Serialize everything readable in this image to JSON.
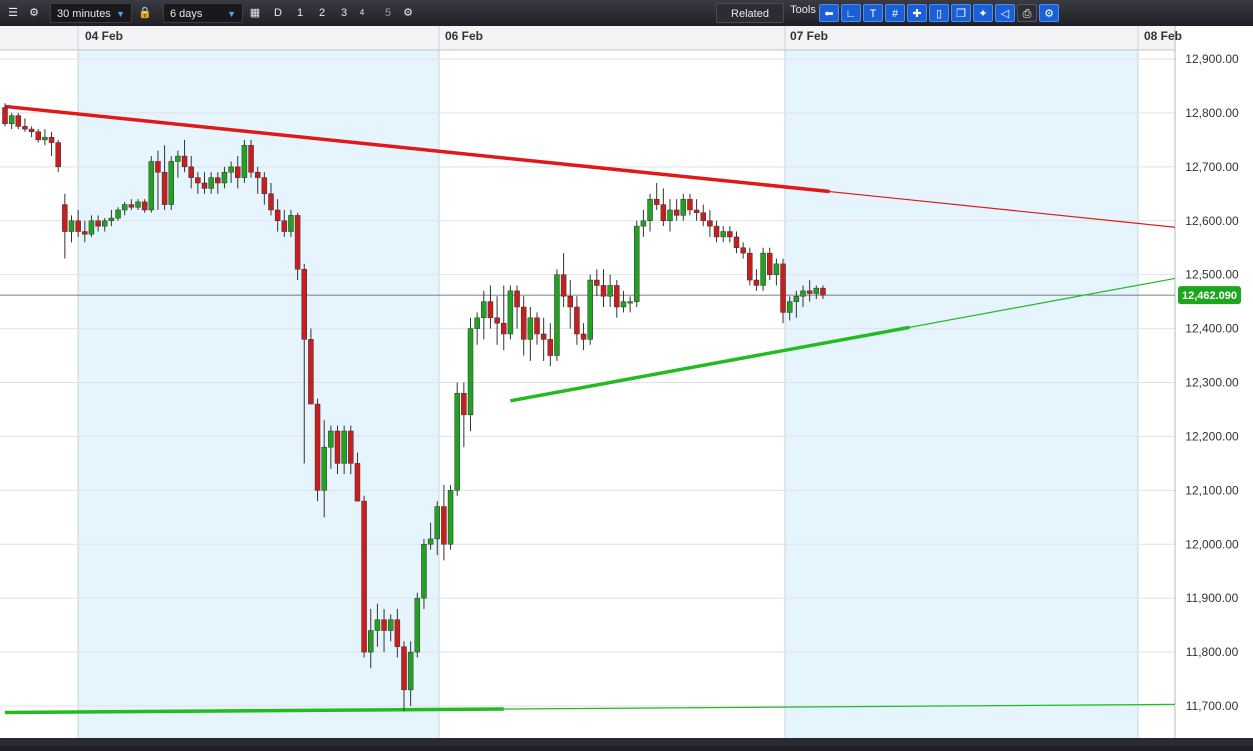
{
  "toolbar": {
    "interval": "30 minutes",
    "range": "6 days",
    "period_buttons": [
      "D",
      "1",
      "2",
      "3",
      "4",
      "5"
    ],
    "related_label": "Related",
    "tools_label": "Tools",
    "tool_icons": [
      "arrow-left-icon",
      "curve-icon",
      "text-icon",
      "grid-icon",
      "crosshair-icon",
      "candle-icon",
      "layers-icon",
      "fan-icon",
      "label-icon",
      "eraser-icon",
      "print-icon",
      "settings-icon"
    ]
  },
  "chart_data": {
    "type": "candlestick",
    "x_ticks": [
      "04 Feb",
      "06 Feb",
      "07 Feb",
      "08 Feb"
    ],
    "y_ticks": [
      "12,900.00",
      "12,800.00",
      "12,700.00",
      "12,600.00",
      "12,500.00",
      "12,400.00",
      "12,300.00",
      "12,200.00",
      "12,100.00",
      "12,000.00",
      "11,900.00",
      "11,800.00",
      "11,700.00"
    ],
    "ylim": [
      11680,
      12930
    ],
    "last_price": "12,462.090",
    "last_price_value": 12462.09,
    "up_color": "#22a122",
    "down_color": "#c81e1e",
    "trendlines": [
      {
        "name": "resistance",
        "color": "#e01818",
        "from": [
          0,
          12812
        ],
        "to": [
          176,
          12588
        ]
      },
      {
        "name": "support",
        "color": "#22bb22",
        "from": [
          76,
          12266
        ],
        "to": [
          176,
          12493
        ]
      },
      {
        "name": "base",
        "color": "#22bb22",
        "from": [
          0,
          11688
        ],
        "to": [
          176,
          11703
        ]
      }
    ],
    "candles": [
      [
        12810,
        12818,
        12775,
        12780
      ],
      [
        12780,
        12800,
        12770,
        12795
      ],
      [
        12795,
        12800,
        12770,
        12775
      ],
      [
        12775,
        12790,
        12765,
        12770
      ],
      [
        12770,
        12775,
        12755,
        12765
      ],
      [
        12765,
        12770,
        12745,
        12750
      ],
      [
        12750,
        12770,
        12740,
        12755
      ],
      [
        12755,
        12765,
        12720,
        12745
      ],
      [
        12745,
        12750,
        12690,
        12700
      ],
      [
        12630,
        12650,
        12530,
        12580
      ],
      [
        12580,
        12610,
        12560,
        12600
      ],
      [
        12600,
        12620,
        12570,
        12580
      ],
      [
        12580,
        12600,
        12560,
        12575
      ],
      [
        12575,
        12610,
        12570,
        12600
      ],
      [
        12600,
        12610,
        12580,
        12590
      ],
      [
        12590,
        12605,
        12580,
        12600
      ],
      [
        12600,
        12620,
        12590,
        12605
      ],
      [
        12605,
        12625,
        12600,
        12620
      ],
      [
        12620,
        12635,
        12610,
        12630
      ],
      [
        12630,
        12640,
        12620,
        12625
      ],
      [
        12625,
        12640,
        12620,
        12635
      ],
      [
        12635,
        12640,
        12615,
        12620
      ],
      [
        12620,
        12720,
        12615,
        12710
      ],
      [
        12710,
        12730,
        12620,
        12690
      ],
      [
        12690,
        12740,
        12620,
        12630
      ],
      [
        12630,
        12720,
        12620,
        12710
      ],
      [
        12710,
        12730,
        12680,
        12720
      ],
      [
        12720,
        12750,
        12690,
        12700
      ],
      [
        12700,
        12720,
        12660,
        12680
      ],
      [
        12680,
        12690,
        12650,
        12670
      ],
      [
        12670,
        12690,
        12650,
        12660
      ],
      [
        12660,
        12690,
        12650,
        12680
      ],
      [
        12680,
        12690,
        12650,
        12670
      ],
      [
        12670,
        12700,
        12660,
        12690
      ],
      [
        12690,
        12710,
        12670,
        12700
      ],
      [
        12700,
        12720,
        12660,
        12680
      ],
      [
        12680,
        12750,
        12670,
        12740
      ],
      [
        12740,
        12750,
        12680,
        12690
      ],
      [
        12690,
        12700,
        12650,
        12680
      ],
      [
        12680,
        12690,
        12630,
        12650
      ],
      [
        12650,
        12670,
        12610,
        12620
      ],
      [
        12620,
        12640,
        12580,
        12600
      ],
      [
        12600,
        12620,
        12570,
        12580
      ],
      [
        12580,
        12620,
        12570,
        12610
      ],
      [
        12610,
        12615,
        12490,
        12510
      ],
      [
        12510,
        12520,
        12150,
        12380
      ],
      [
        12380,
        12400,
        12280,
        12260
      ],
      [
        12260,
        12270,
        12080,
        12100
      ],
      [
        12100,
        12230,
        12050,
        12180
      ],
      [
        12180,
        12220,
        12140,
        12210
      ],
      [
        12210,
        12220,
        12130,
        12150
      ],
      [
        12150,
        12220,
        12130,
        12210
      ],
      [
        12210,
        12220,
        12130,
        12150
      ],
      [
        12150,
        12170,
        12080,
        12080
      ],
      [
        12080,
        12090,
        11790,
        11800
      ],
      [
        11800,
        11880,
        11770,
        11840
      ],
      [
        11840,
        11890,
        11810,
        11860
      ],
      [
        11860,
        11880,
        11800,
        11840
      ],
      [
        11840,
        11870,
        11820,
        11860
      ],
      [
        11860,
        11880,
        11790,
        11810
      ],
      [
        11810,
        11820,
        11690,
        11730
      ],
      [
        11730,
        11820,
        11700,
        11800
      ],
      [
        11800,
        11910,
        11790,
        11900
      ],
      [
        11900,
        12010,
        11880,
        12000
      ],
      [
        12000,
        12040,
        11990,
        12010
      ],
      [
        12010,
        12080,
        11980,
        12070
      ],
      [
        12070,
        12110,
        11970,
        12000
      ],
      [
        12000,
        12110,
        11990,
        12100
      ],
      [
        12100,
        12300,
        12090,
        12280
      ],
      [
        12280,
        12300,
        12180,
        12240
      ],
      [
        12240,
        12420,
        12210,
        12400
      ],
      [
        12400,
        12430,
        12370,
        12420
      ],
      [
        12420,
        12470,
        12380,
        12450
      ],
      [
        12450,
        12480,
        12400,
        12420
      ],
      [
        12420,
        12460,
        12370,
        12410
      ],
      [
        12410,
        12480,
        12360,
        12390
      ],
      [
        12390,
        12480,
        12380,
        12470
      ],
      [
        12470,
        12480,
        12400,
        12440
      ],
      [
        12440,
        12460,
        12350,
        12380
      ],
      [
        12380,
        12440,
        12340,
        12420
      ],
      [
        12420,
        12430,
        12370,
        12390
      ],
      [
        12390,
        12420,
        12340,
        12380
      ],
      [
        12380,
        12410,
        12330,
        12350
      ],
      [
        12350,
        12510,
        12340,
        12500
      ],
      [
        12500,
        12540,
        12440,
        12460
      ],
      [
        12460,
        12490,
        12400,
        12440
      ],
      [
        12440,
        12460,
        12370,
        12390
      ],
      [
        12390,
        12410,
        12360,
        12380
      ],
      [
        12380,
        12500,
        12370,
        12490
      ],
      [
        12490,
        12510,
        12460,
        12480
      ],
      [
        12480,
        12510,
        12440,
        12460
      ],
      [
        12460,
        12500,
        12440,
        12480
      ],
      [
        12480,
        12490,
        12420,
        12440
      ],
      [
        12440,
        12470,
        12430,
        12450
      ],
      [
        12450,
        12460,
        12430,
        12450
      ],
      [
        12450,
        12600,
        12440,
        12590
      ],
      [
        12590,
        12620,
        12570,
        12600
      ],
      [
        12600,
        12650,
        12580,
        12640
      ],
      [
        12640,
        12670,
        12620,
        12630
      ],
      [
        12630,
        12660,
        12590,
        12600
      ],
      [
        12600,
        12640,
        12580,
        12620
      ],
      [
        12620,
        12640,
        12600,
        12610
      ],
      [
        12610,
        12650,
        12600,
        12640
      ],
      [
        12640,
        12650,
        12610,
        12620
      ],
      [
        12620,
        12640,
        12600,
        12615
      ],
      [
        12615,
        12630,
        12590,
        12600
      ],
      [
        12600,
        12620,
        12570,
        12590
      ],
      [
        12590,
        12600,
        12560,
        12570
      ],
      [
        12570,
        12590,
        12560,
        12580
      ],
      [
        12580,
        12590,
        12560,
        12570
      ],
      [
        12570,
        12580,
        12540,
        12550
      ],
      [
        12550,
        12560,
        12530,
        12540
      ],
      [
        12540,
        12550,
        12480,
        12490
      ],
      [
        12490,
        12510,
        12470,
        12480
      ],
      [
        12480,
        12550,
        12470,
        12540
      ],
      [
        12540,
        12550,
        12490,
        12500
      ],
      [
        12500,
        12530,
        12480,
        12520
      ],
      [
        12520,
        12530,
        12410,
        12430
      ],
      [
        12430,
        12460,
        12415,
        12450
      ],
      [
        12450,
        12470,
        12420,
        12460
      ],
      [
        12460,
        12480,
        12440,
        12470
      ],
      [
        12470,
        12490,
        12450,
        12465
      ],
      [
        12465,
        12480,
        12455,
        12475
      ],
      [
        12475,
        12480,
        12455,
        12462
      ]
    ]
  }
}
